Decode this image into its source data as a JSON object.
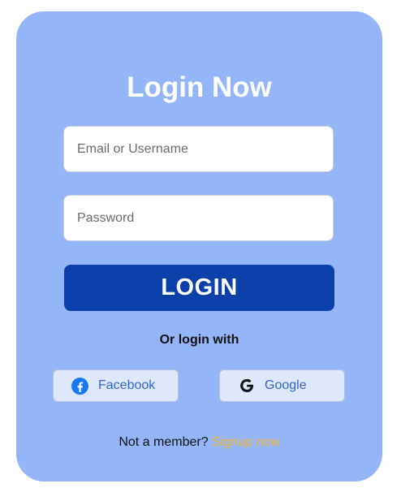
{
  "login": {
    "title": "Login Now",
    "email_placeholder": "Email or Username",
    "email_value": "",
    "password_placeholder": "Password",
    "password_value": "",
    "login_button": "LOGIN",
    "or_text": "Or login with",
    "social": [
      {
        "label": "Facebook",
        "icon": "facebook-icon"
      },
      {
        "label": "Google",
        "icon": "google-icon"
      }
    ],
    "footer_text": "Not a member?",
    "signup_link": "Signup now"
  },
  "colors": {
    "card_bg": "#94b6f9",
    "primary": "#0b40ab",
    "social_bg": "#dfe8fb",
    "social_text": "#2f66d0",
    "link": "#f5b62a",
    "facebook": "#1877f2"
  }
}
